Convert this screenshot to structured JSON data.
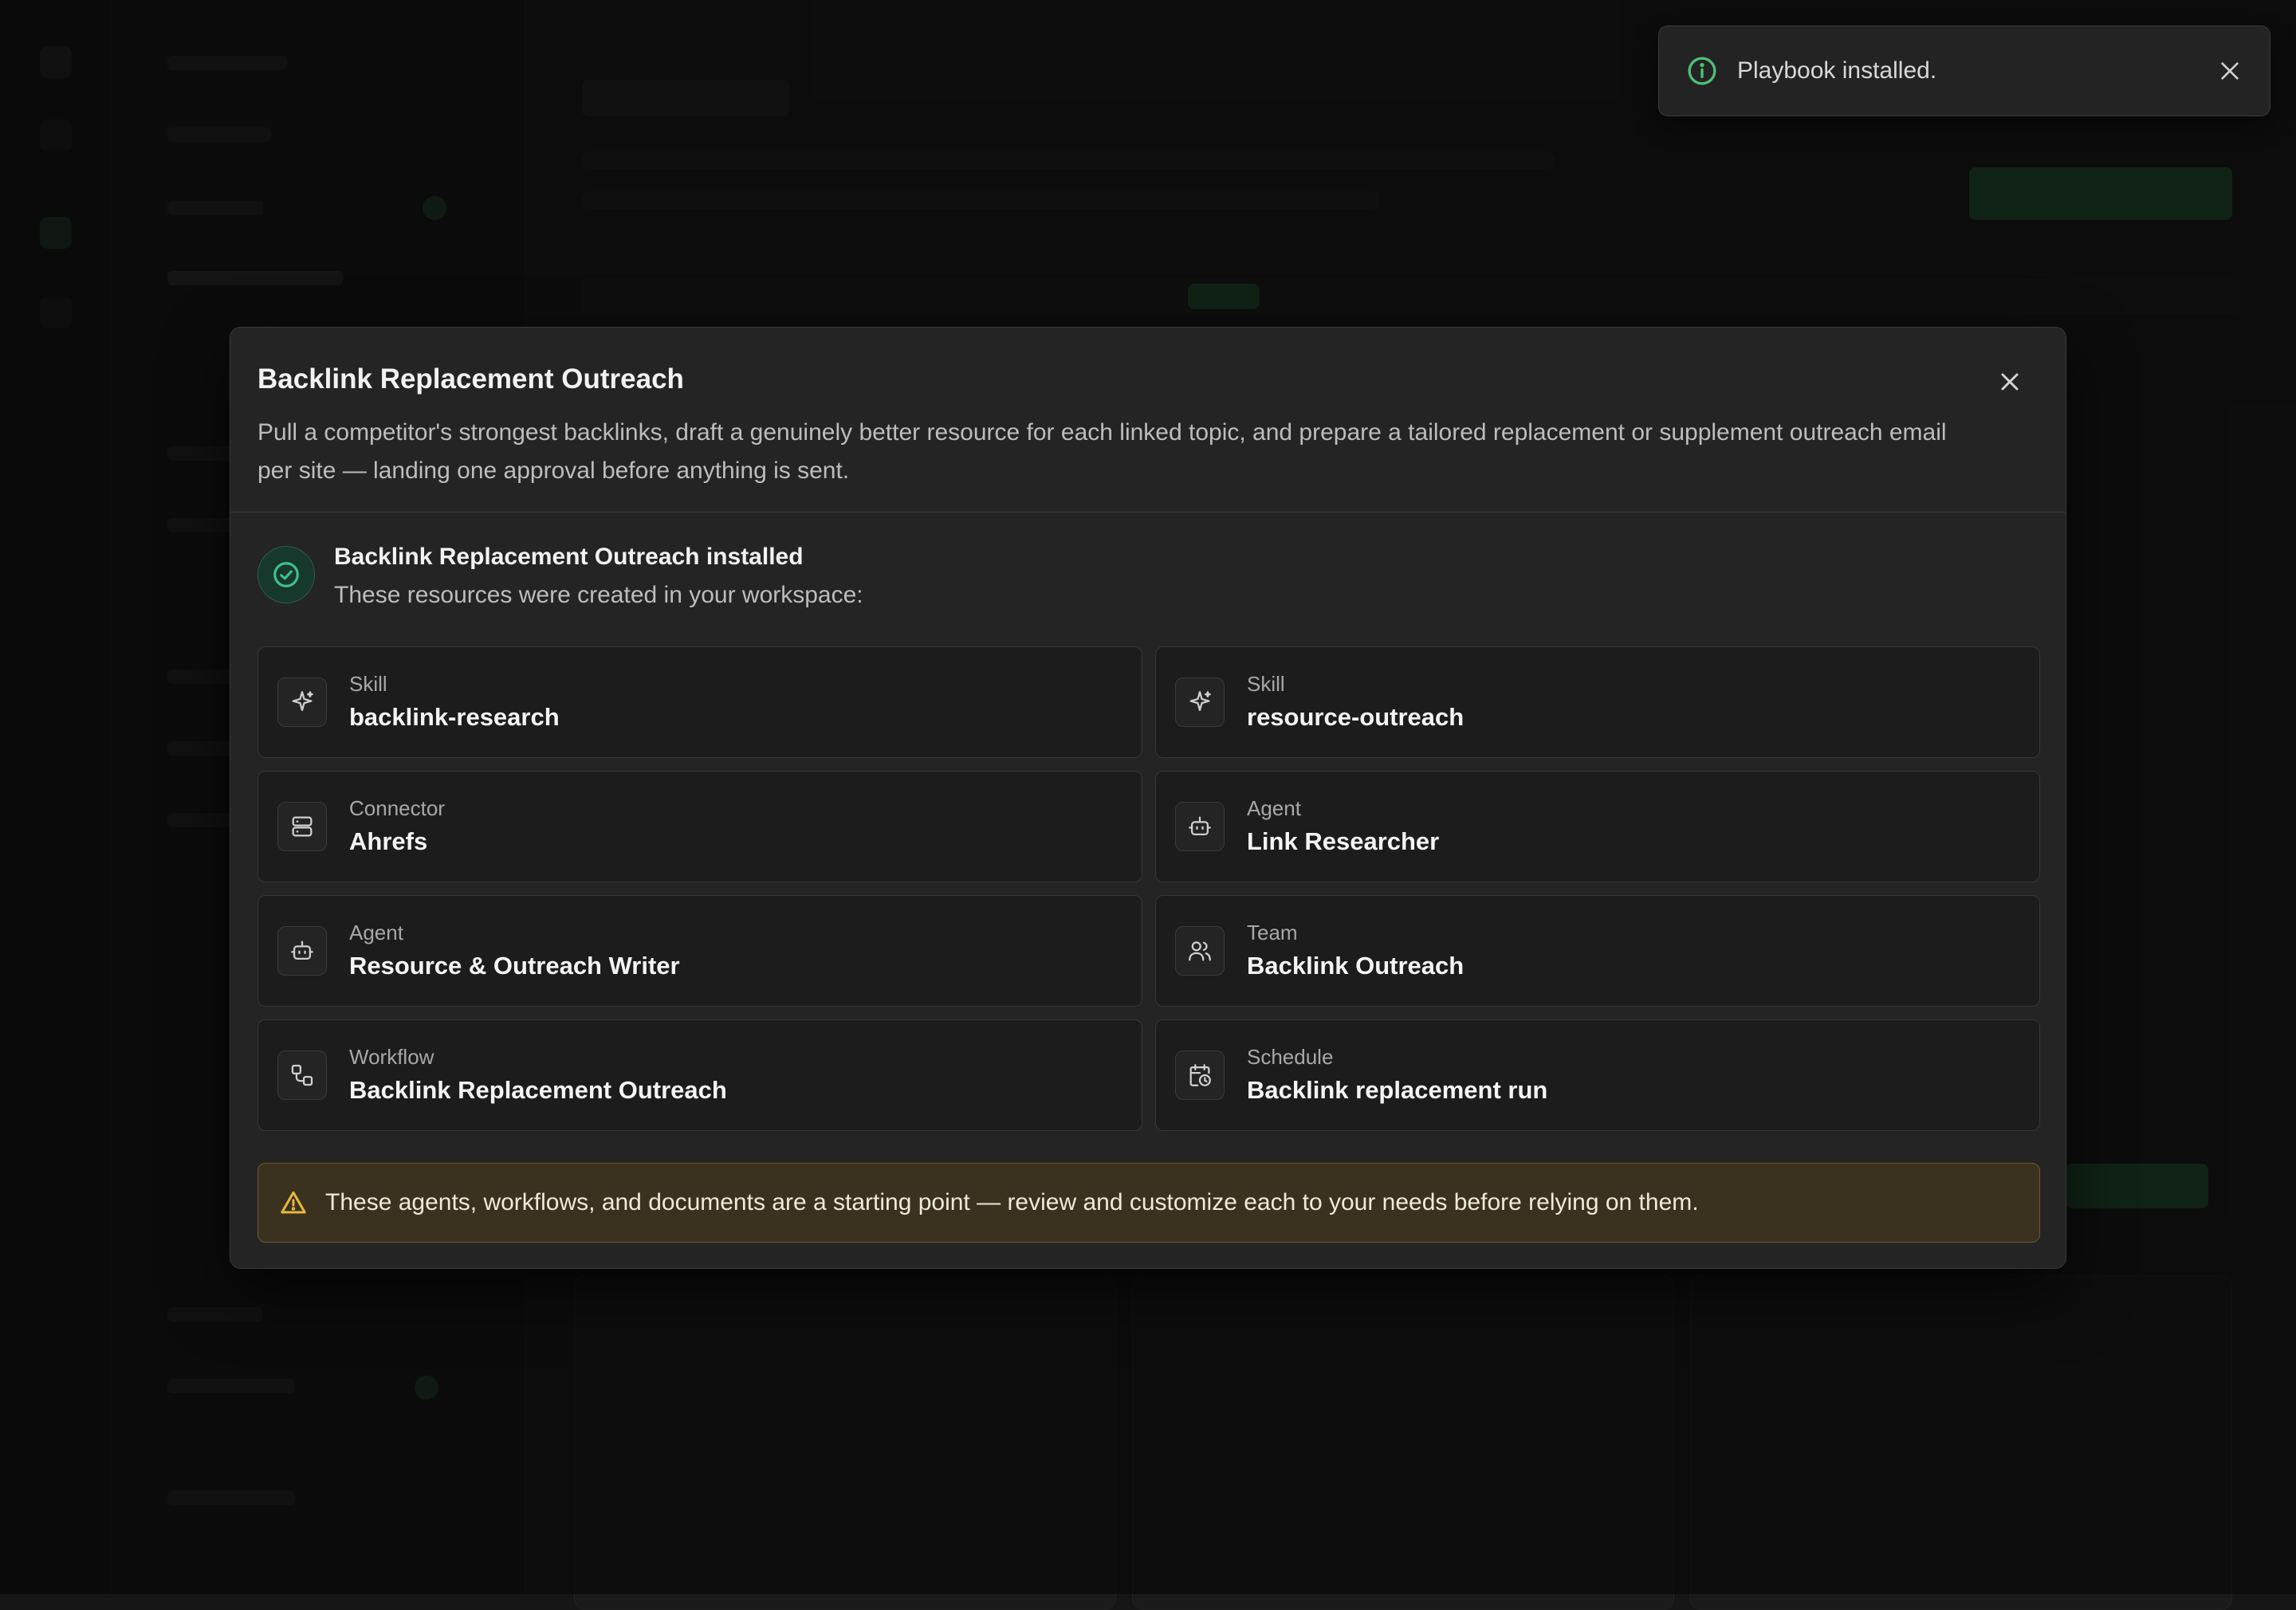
{
  "toast": {
    "message": "Playbook installed.",
    "icon": "info-circle-icon",
    "accent": "#4fbf75"
  },
  "modal": {
    "title": "Backlink Replacement Outreach",
    "description": "Pull a competitor's strongest backlinks, draft a genuinely better resource for each linked topic, and prepare a tailored replacement or supplement outreach email per site — landing one approval before anything is sent.",
    "success": {
      "title": "Backlink Replacement Outreach installed",
      "subtitle": "These resources were created in your workspace:",
      "accent": "#3fbf8f"
    },
    "resources": [
      {
        "kind": "Skill",
        "name": "backlink-research",
        "icon": "sparkle-icon"
      },
      {
        "kind": "Skill",
        "name": "resource-outreach",
        "icon": "sparkle-icon"
      },
      {
        "kind": "Connector",
        "name": "Ahrefs",
        "icon": "server-icon"
      },
      {
        "kind": "Agent",
        "name": "Link Researcher",
        "icon": "bot-icon"
      },
      {
        "kind": "Agent",
        "name": "Resource & Outreach Writer",
        "icon": "bot-icon"
      },
      {
        "kind": "Team",
        "name": "Backlink Outreach",
        "icon": "users-icon"
      },
      {
        "kind": "Workflow",
        "name": "Backlink Replacement Outreach",
        "icon": "workflow-icon"
      },
      {
        "kind": "Schedule",
        "name": "Backlink replacement run",
        "icon": "calendar-clock-icon"
      }
    ],
    "warning": {
      "text": "These agents, workflows, and documents are a starting point — review and customize each to your needs before relying on them.",
      "color": "#e8b73a"
    }
  }
}
